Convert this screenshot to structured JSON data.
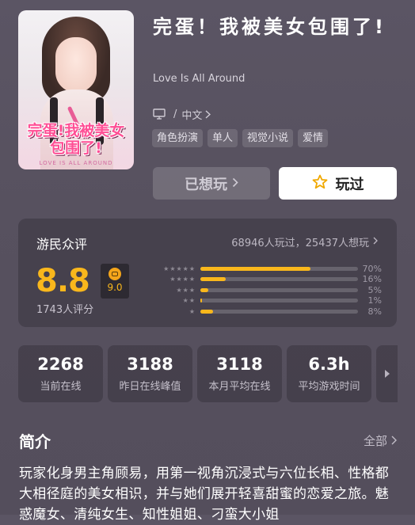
{
  "game": {
    "cover_title_art": "完蛋!我被美女包围了!",
    "cover_sub_art": "LOVE IS ALL AROUND",
    "title": "完蛋！我被美女包围了!",
    "english_title": "Love Is All Around",
    "platform_icon": "monitor-icon",
    "language": "中文",
    "tags": [
      "角色扮演",
      "单人",
      "视觉小说",
      "爱情"
    ]
  },
  "actions": {
    "wished_label": "已想玩",
    "played_label": "玩过",
    "played_icon": "star-outline-icon"
  },
  "review": {
    "label": "游民众评",
    "stats": "68946人玩过，25437人想玩",
    "score": "8.8",
    "badge_score": "9.0",
    "rating_count": "1743人评分",
    "distribution": [
      {
        "stars": "★★★★★",
        "percent": 70,
        "label": "70%"
      },
      {
        "stars": "★★★★",
        "percent": 16,
        "label": "16%"
      },
      {
        "stars": "★★★",
        "percent": 5,
        "label": "5%"
      },
      {
        "stars": "★★",
        "percent": 1,
        "label": "1%"
      },
      {
        "stars": "★",
        "percent": 8,
        "label": "8%"
      }
    ]
  },
  "metrics": [
    {
      "value": "2268",
      "caption": "当前在线"
    },
    {
      "value": "3188",
      "caption": "昨日在线峰值"
    },
    {
      "value": "3118",
      "caption": "本月平均在线"
    },
    {
      "value": "6.3h",
      "caption": "平均游戏时间"
    }
  ],
  "intro": {
    "heading": "简介",
    "all_label": "全部",
    "text": "玩家化身男主角顾易，用第一视角沉浸式与六位长相、性格都大相径庭的美女相识，并与她们展开轻喜甜蜜的恋爱之旅。魅惑魔女、清纯女生、知性姐姐、刁蛮大小姐"
  },
  "colors": {
    "accent": "#f9b71c",
    "background": "#57515f"
  }
}
